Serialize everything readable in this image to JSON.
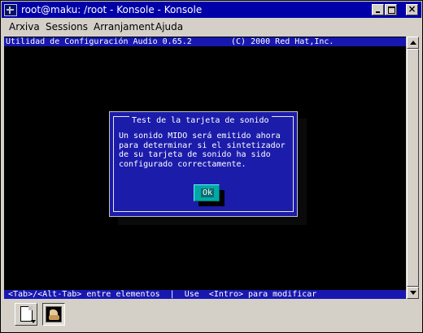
{
  "window": {
    "title": "root@maku: /root - Konsole - Konsole",
    "close_glyph": "×"
  },
  "menubar": {
    "items": [
      "Arxiva",
      "Sessions",
      "Arranjament",
      "Ajuda"
    ]
  },
  "terminal": {
    "header_app": "Utilidad de Configuración Audio 0.65.2",
    "header_copy": "(C) 2000 Red Hat,Inc.",
    "footer": "<Tab>/<Alt-Tab> entre elementos  |  Use  <Intro> para modificar",
    "colors": {
      "background": "#000000",
      "bar": "#1818b0",
      "dialog": "#1c1cab",
      "button": "#00a8a8"
    }
  },
  "dialog": {
    "title": "Test de la tarjeta de sonido",
    "message_lines": [
      "Un sonido MIDO será emitido ahora",
      "para determinar si el sintetizador",
      "de su tarjeta de sonido ha sido",
      "configurado correctamente."
    ],
    "ok_label": "Ok"
  },
  "tabbar": {
    "new_session_icon": "new-document-icon",
    "session_icon": "konsole-session-icon"
  }
}
